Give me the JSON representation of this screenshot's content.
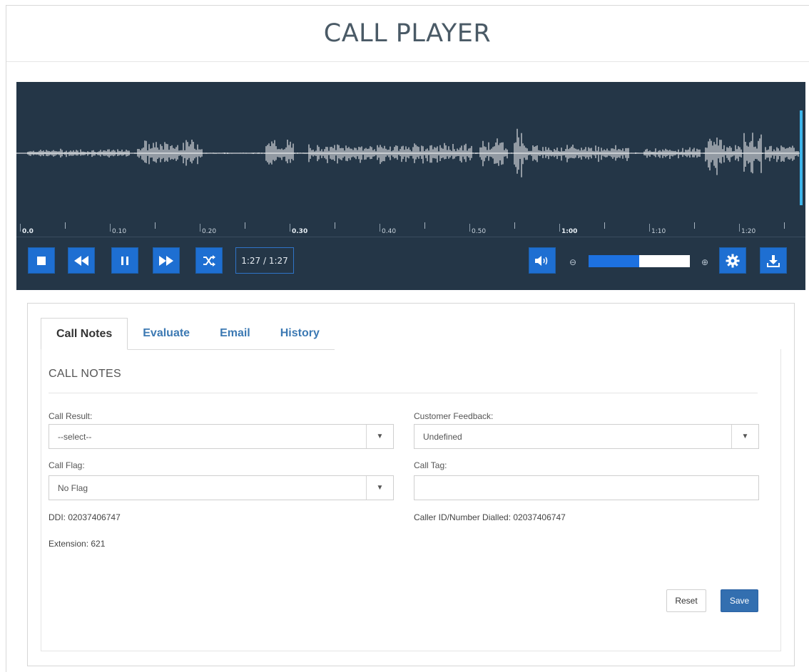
{
  "page": {
    "title": "CALL PLAYER"
  },
  "player": {
    "timeline": [
      {
        "label": "0.0",
        "bold": true
      },
      {
        "label": "0.10",
        "bold": false
      },
      {
        "label": "0.20",
        "bold": false
      },
      {
        "label": "0.30",
        "bold": true
      },
      {
        "label": "0.40",
        "bold": false
      },
      {
        "label": "0.50",
        "bold": false
      },
      {
        "label": "1:00",
        "bold": true
      },
      {
        "label": "1:10",
        "bold": false
      },
      {
        "label": "1:20",
        "bold": false
      }
    ],
    "time_display": "1:27 / 1:27",
    "volume_level": 0.5,
    "controls": [
      "stop-icon",
      "rewind-icon",
      "pause-icon",
      "fast-forward-icon",
      "shuffle-icon",
      "volume-icon",
      "zoom-out-icon",
      "zoom-in-icon",
      "gear-icon",
      "download-icon"
    ],
    "colors": {
      "background": "#243647",
      "button": "#1e6fd2",
      "marker": "#3db5ea",
      "waveform": "#ffffff"
    }
  },
  "tabs": [
    {
      "label": "Call Notes",
      "active": true
    },
    {
      "label": "Evaluate",
      "active": false
    },
    {
      "label": "Email",
      "active": false
    },
    {
      "label": "History",
      "active": false
    }
  ],
  "call_notes": {
    "section_title": "CALL NOTES",
    "call_result": {
      "label": "Call Result:",
      "value": "--select--"
    },
    "customer_feedback": {
      "label": "Customer Feedback:",
      "value": "Undefined"
    },
    "call_flag": {
      "label": "Call Flag:",
      "value": "No Flag"
    },
    "call_tag": {
      "label": "Call Tag:",
      "value": ""
    },
    "ddi": "DDI: 02037406747",
    "caller_id": "Caller ID/Number Dialled: 02037406747",
    "extension": "Extension: 621",
    "reset_label": "Reset",
    "save_label": "Save"
  }
}
